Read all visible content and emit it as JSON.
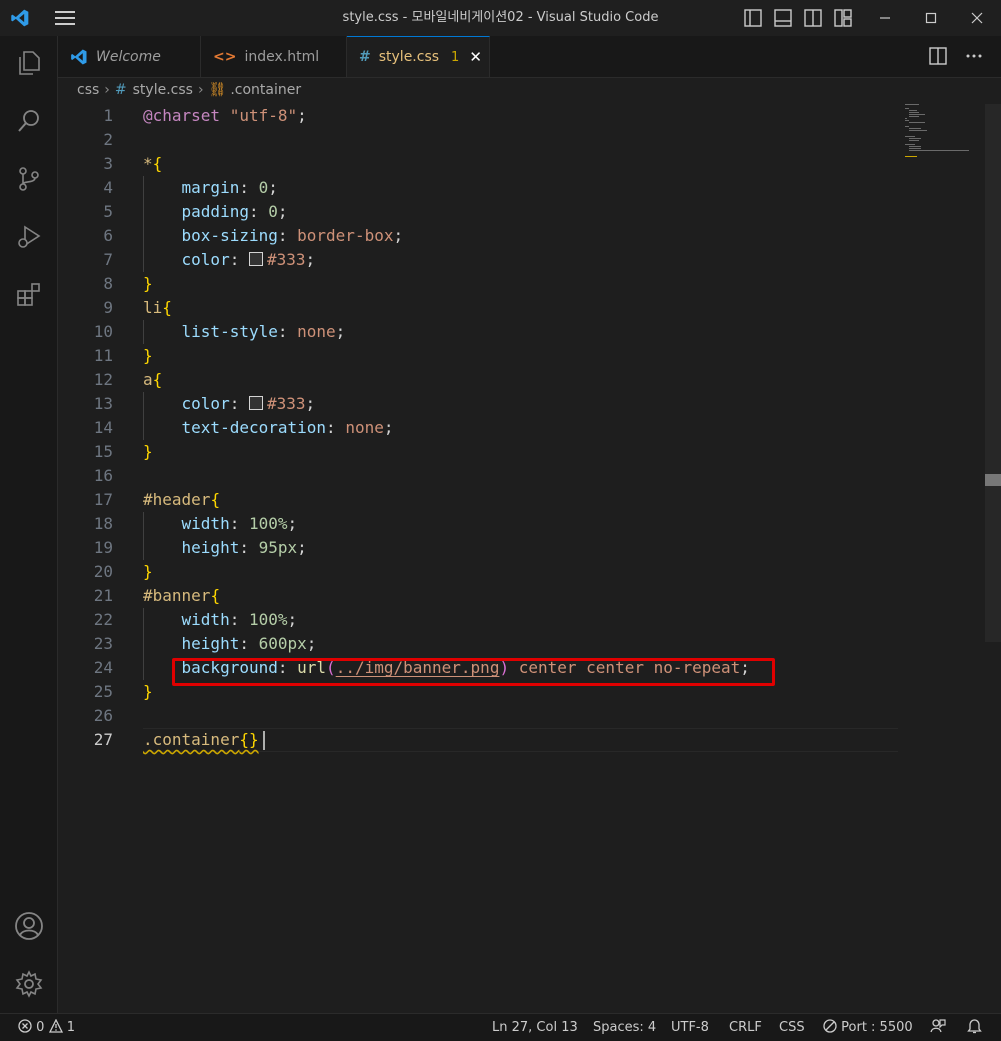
{
  "window": {
    "title": "style.css - 모바일네비게이션02 - Visual Studio Code"
  },
  "tabs": [
    {
      "label": "Welcome",
      "icon": "vscode-icon"
    },
    {
      "label": "index.html",
      "icon": "html-icon"
    },
    {
      "label": "style.css",
      "icon": "css-hash-icon",
      "badge": "1",
      "active": true
    }
  ],
  "breadcrumb": {
    "folder": "css",
    "file": "style.css",
    "symbol": ".container"
  },
  "editor": {
    "line_numbers": [
      "1",
      "2",
      "3",
      "4",
      "5",
      "6",
      "7",
      "8",
      "9",
      "10",
      "11",
      "12",
      "13",
      "14",
      "15",
      "16",
      "17",
      "18",
      "19",
      "20",
      "21",
      "22",
      "23",
      "24",
      "25",
      "26",
      "27"
    ],
    "current_line": "27",
    "colors": {
      "swatch": "#333333",
      "highlight_box": "#e00000"
    },
    "code": {
      "l1_at": "@charset",
      "l1_str": "\"utf-8\"",
      "l1_end": ";",
      "l3_sel": "*",
      "open": "{",
      "close": "}",
      "margin": "margin",
      "padding": "padding",
      "box_sizing": "box-sizing",
      "color": "color",
      "zero": "0",
      "border_box": "border-box",
      "hex333": "#333",
      "li": "li",
      "list_style": "list-style",
      "none": "none",
      "a": "a",
      "text_decoration": "text-decoration",
      "header": "#header",
      "width": "width",
      "height": "height",
      "pct100": "100%",
      "h95": "95px",
      "banner": "#banner",
      "h600": "600px",
      "background": "background",
      "url_fn": "url",
      "lparen": "(",
      "rparen": ")",
      "url_path": "../img/banner.png",
      "bg_rest": "center center no-repeat",
      "container": ".container",
      "empty_braces": "{}",
      "colon": ":",
      "semi": ";"
    }
  },
  "statusbar": {
    "errors": "0",
    "warnings": "1",
    "position": "Ln 27, Col 13",
    "spaces": "Spaces: 4",
    "encoding": "UTF-8",
    "eol": "CRLF",
    "language": "CSS",
    "port": "Port : 5500"
  }
}
